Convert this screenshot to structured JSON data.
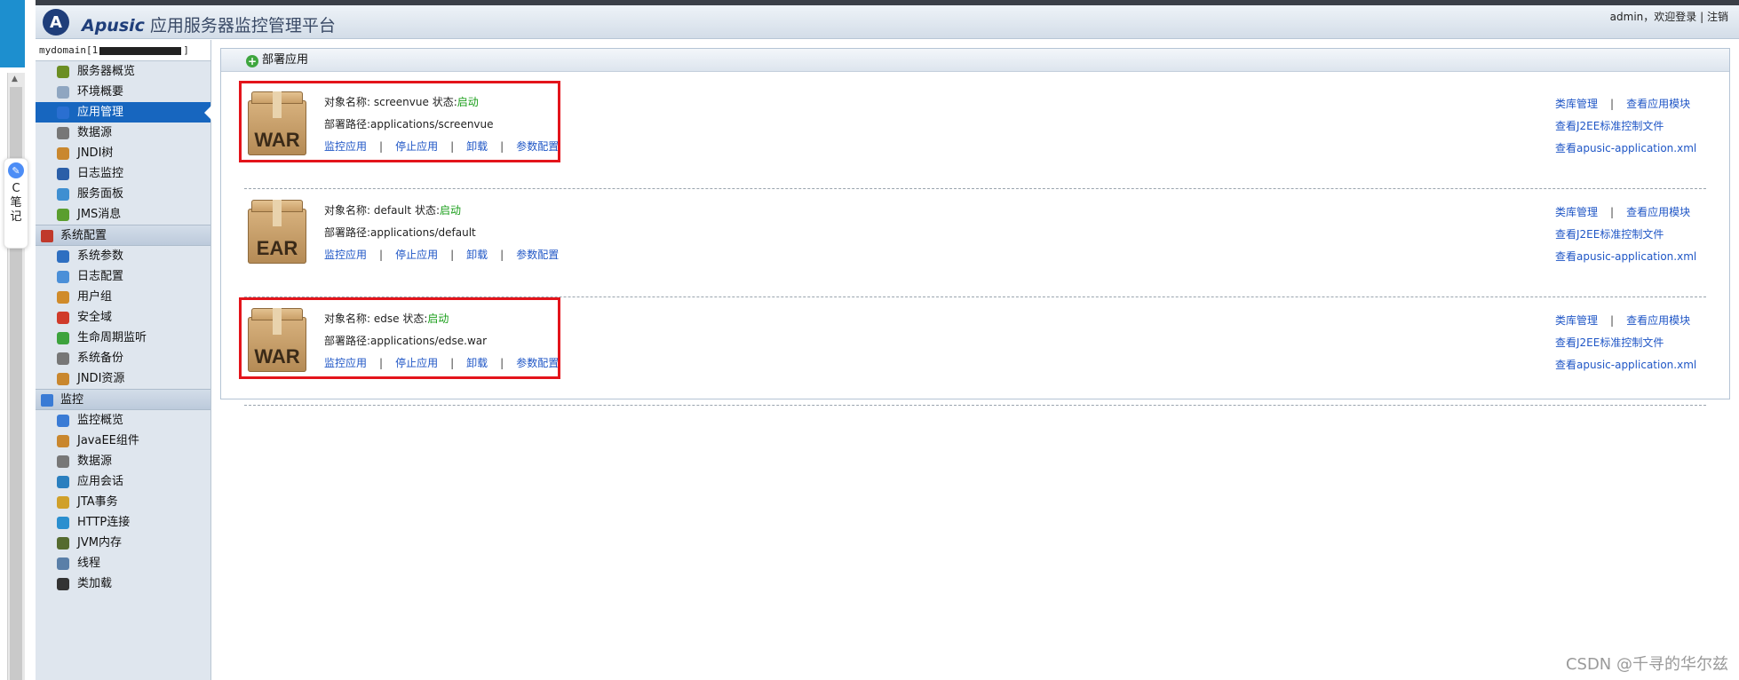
{
  "header": {
    "brand": "Apusic",
    "subtitle": "应用服务器监控管理平台",
    "user_text": "admin，欢迎登录",
    "separator": "|",
    "logout": "注销"
  },
  "browser_side": {
    "note_widget_lines": [
      "C",
      "笔",
      "记"
    ]
  },
  "sidebar": {
    "domain_prefix": "mydomain[1",
    "domain_suffix": "]",
    "items_server": [
      {
        "label": "服务器概览",
        "icon": "server-overview-icon",
        "color": "#6b8e23"
      },
      {
        "label": "环境概要",
        "icon": "environment-icon",
        "color": "#8fa6c1"
      },
      {
        "label": "应用管理",
        "icon": "app-manage-icon",
        "color": "#2a6fd1",
        "active": true
      },
      {
        "label": "数据源",
        "icon": "datasource-icon",
        "color": "#777777"
      },
      {
        "label": "JNDI树",
        "icon": "jndi-tree-icon",
        "color": "#c9872e"
      },
      {
        "label": "日志监控",
        "icon": "log-monitor-icon",
        "color": "#2b5fa8"
      },
      {
        "label": "服务面板",
        "icon": "service-panel-icon",
        "color": "#3f8fd1"
      },
      {
        "label": "JMS消息",
        "icon": "jms-message-icon",
        "color": "#5a9e2e"
      }
    ],
    "group_config": {
      "label": "系统配置",
      "icon": "system-config-icon",
      "color": "#c0392b"
    },
    "items_config": [
      {
        "label": "系统参数",
        "icon": "system-params-icon",
        "color": "#2e6fc1"
      },
      {
        "label": "日志配置",
        "icon": "log-config-icon",
        "color": "#4a8fd8"
      },
      {
        "label": "用户组",
        "icon": "user-group-icon",
        "color": "#d08b2a"
      },
      {
        "label": "安全域",
        "icon": "security-domain-icon",
        "color": "#d03b2a"
      },
      {
        "label": "生命周期监听",
        "icon": "lifecycle-icon",
        "color": "#3da33d"
      },
      {
        "label": "系统备份",
        "icon": "system-backup-icon",
        "color": "#777777"
      },
      {
        "label": "JNDI资源",
        "icon": "jndi-resource-icon",
        "color": "#c9872e"
      }
    ],
    "group_monitor": {
      "label": "监控",
      "icon": "monitor-icon",
      "color": "#3a7bd5"
    },
    "items_monitor": [
      {
        "label": "监控概览",
        "icon": "monitor-overview-icon",
        "color": "#3a7bd5"
      },
      {
        "label": "JavaEE组件",
        "icon": "javaee-component-icon",
        "color": "#c9872e"
      },
      {
        "label": "数据源",
        "icon": "datasource-icon",
        "color": "#777777"
      },
      {
        "label": "应用会话",
        "icon": "app-session-icon",
        "color": "#2a7fbf"
      },
      {
        "label": "JTA事务",
        "icon": "jta-transaction-icon",
        "color": "#d0a02a"
      },
      {
        "label": "HTTP连接",
        "icon": "http-connection-icon",
        "color": "#2a8fcf"
      },
      {
        "label": "JVM内存",
        "icon": "jvm-memory-icon",
        "color": "#556b2f"
      },
      {
        "label": "线程",
        "icon": "thread-icon",
        "color": "#5a7fa8"
      },
      {
        "label": "类加载",
        "icon": "class-loading-icon",
        "color": "#333333"
      }
    ]
  },
  "panel": {
    "deploy_label": "部署应用"
  },
  "labels": {
    "object_name": "对象名称:",
    "status": "状态:",
    "deploy_path": "部署路径:",
    "monitor": "监控应用",
    "stop": "停止应用",
    "uninstall": "卸载",
    "params": "参数配置",
    "lib_manage": "类库管理",
    "view_modules": "查看应用模块",
    "view_j2ee": "查看J2EE标准控制文件",
    "view_xml": "查看apusic-application.xml",
    "bar": "|"
  },
  "apps": [
    {
      "type": "WAR",
      "name": "screenvue",
      "status": "启动",
      "path": "applications/screenvue",
      "highlighted": true
    },
    {
      "type": "EAR",
      "name": "default",
      "status": "启动",
      "path": "applications/default",
      "highlighted": false
    },
    {
      "type": "WAR",
      "name": "edse",
      "status": "启动",
      "path": "applications/edse.war",
      "highlighted": true
    }
  ],
  "watermark": "CSDN @千寻的华尔兹",
  "colors": {
    "highlight": "#e3141b",
    "status_green": "#1a9e1a",
    "link_blue": "#1f56c6",
    "nav_active": "#1766bf"
  }
}
